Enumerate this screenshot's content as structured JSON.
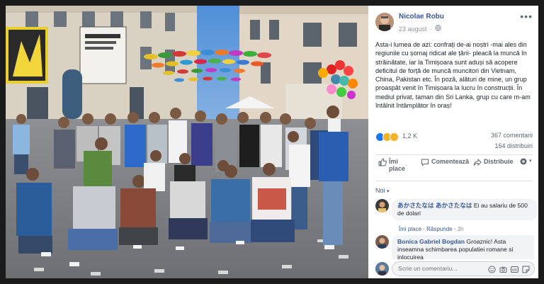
{
  "post": {
    "author": "Nicolae Robu",
    "date": "23 august",
    "privacy_icon": "globe-icon",
    "text": "Asta-i lumea de azi: confrați de-ai noștri -mai ales din regiunile cu șomaj ridicat ale țării- pleacă la muncă în străinătate, iar la Timișoara sunt aduși să acopere deficitul de forță de muncă muncitori din Vietnam, China, Pakistan etc. În poză, alături de mine, un grup proaspăt venit în Timișoara la lucru în construcții. În mediul privat, taman din Sri Lanka, grup cu care m-am întâlnit întâmplător în oraș!"
  },
  "reactions": {
    "count": "1,2 K",
    "icons": [
      "like-icon",
      "sad-icon",
      "wow-icon"
    ],
    "comments": "367 comentarii",
    "shares": "164 distribuiri"
  },
  "actions": {
    "like": "Îmi place",
    "comment": "Comentează",
    "share": "Distribuie"
  },
  "sort": "Noi",
  "comments": [
    {
      "name": "あかさたなは あかさたなは",
      "text": "Ei au salariu de 500 de dolari",
      "like": "Îmi place",
      "reply": "Răspunde",
      "time": "3h"
    },
    {
      "name": "Bonica Gabriel Bogdan",
      "text": "Groaznic! Asta inseamna schimbarea populatiei romane si inlocuirea"
    }
  ],
  "write": {
    "placeholder": "Scrie un comentariu..."
  },
  "colors": {
    "link": "#385898",
    "meta": "#90949c",
    "text": "#1d2129",
    "bubble": "#f2f3f5"
  }
}
